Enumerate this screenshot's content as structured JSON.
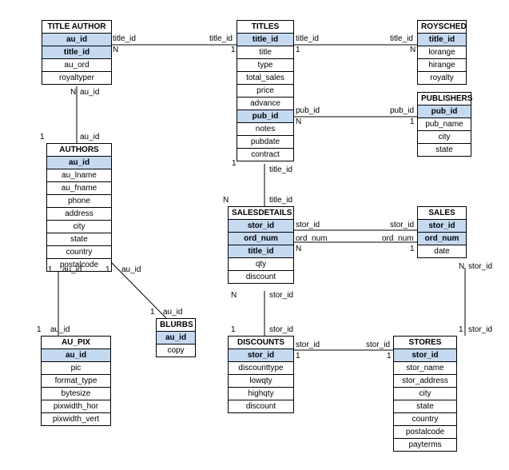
{
  "entities": {
    "title_author": {
      "name": "TITLE AUTHOR",
      "cols": [
        {
          "name": "au_id",
          "pk": true
        },
        {
          "name": "title_id",
          "pk": true
        },
        {
          "name": "au_ord"
        },
        {
          "name": "royaltyper"
        }
      ]
    },
    "titles": {
      "name": "TITLES",
      "cols": [
        {
          "name": "title_id",
          "pk": true
        },
        {
          "name": "title"
        },
        {
          "name": "type"
        },
        {
          "name": "total_sales"
        },
        {
          "name": "price"
        },
        {
          "name": "advance"
        },
        {
          "name": "pub_id",
          "fk": true
        },
        {
          "name": "notes"
        },
        {
          "name": "pubdate"
        },
        {
          "name": "contract"
        }
      ]
    },
    "roysched": {
      "name": "ROYSCHED",
      "cols": [
        {
          "name": "title_id",
          "pk": true
        },
        {
          "name": "lorange"
        },
        {
          "name": "hirange"
        },
        {
          "name": "royalty"
        }
      ]
    },
    "publishers": {
      "name": "PUBLISHERS",
      "cols": [
        {
          "name": "pub_id",
          "pk": true
        },
        {
          "name": "pub_name"
        },
        {
          "name": "city"
        },
        {
          "name": "state"
        }
      ]
    },
    "authors": {
      "name": "AUTHORS",
      "cols": [
        {
          "name": "au_id",
          "pk": true
        },
        {
          "name": "au_lname"
        },
        {
          "name": "au_fname"
        },
        {
          "name": "phone"
        },
        {
          "name": "address"
        },
        {
          "name": "city"
        },
        {
          "name": "state"
        },
        {
          "name": "country"
        },
        {
          "name": "postalcode"
        }
      ]
    },
    "salesdetails": {
      "name": "SALESDETAILS",
      "cols": [
        {
          "name": "stor_id",
          "pk": true
        },
        {
          "name": "ord_num",
          "pk": true
        },
        {
          "name": "title_id",
          "pk": true
        },
        {
          "name": "qty"
        },
        {
          "name": "discount"
        }
      ]
    },
    "sales": {
      "name": "SALES",
      "cols": [
        {
          "name": "stor_id",
          "pk": true
        },
        {
          "name": "ord_num",
          "pk": true
        },
        {
          "name": "date"
        }
      ]
    },
    "blurbs": {
      "name": "BLURBS",
      "cols": [
        {
          "name": "au_id",
          "pk": true
        },
        {
          "name": "copy"
        }
      ]
    },
    "au_pix": {
      "name": "AU_PIX",
      "cols": [
        {
          "name": "au_id",
          "pk": true
        },
        {
          "name": "pic"
        },
        {
          "name": "format_type"
        },
        {
          "name": "bytesize"
        },
        {
          "name": "pixwidth_hor"
        },
        {
          "name": "pixwidth_vert"
        }
      ]
    },
    "discounts": {
      "name": "DISCOUNTS",
      "cols": [
        {
          "name": "stor_id",
          "pk": true
        },
        {
          "name": "discounttype"
        },
        {
          "name": "lowqty"
        },
        {
          "name": "highqty"
        },
        {
          "name": "discount"
        }
      ]
    },
    "stores": {
      "name": "STORES",
      "cols": [
        {
          "name": "stor_id",
          "pk": true
        },
        {
          "name": "stor_name"
        },
        {
          "name": "stor_address"
        },
        {
          "name": "city"
        },
        {
          "name": "state"
        },
        {
          "name": "country"
        },
        {
          "name": "postalcode"
        },
        {
          "name": "payterms"
        }
      ]
    }
  },
  "labels": {
    "title_id": "title_id",
    "au_id": "au_id",
    "pub_id": "pub_id",
    "stor_id": "stor_id",
    "ord_num": "ord_num",
    "one": "1",
    "N": "N"
  }
}
